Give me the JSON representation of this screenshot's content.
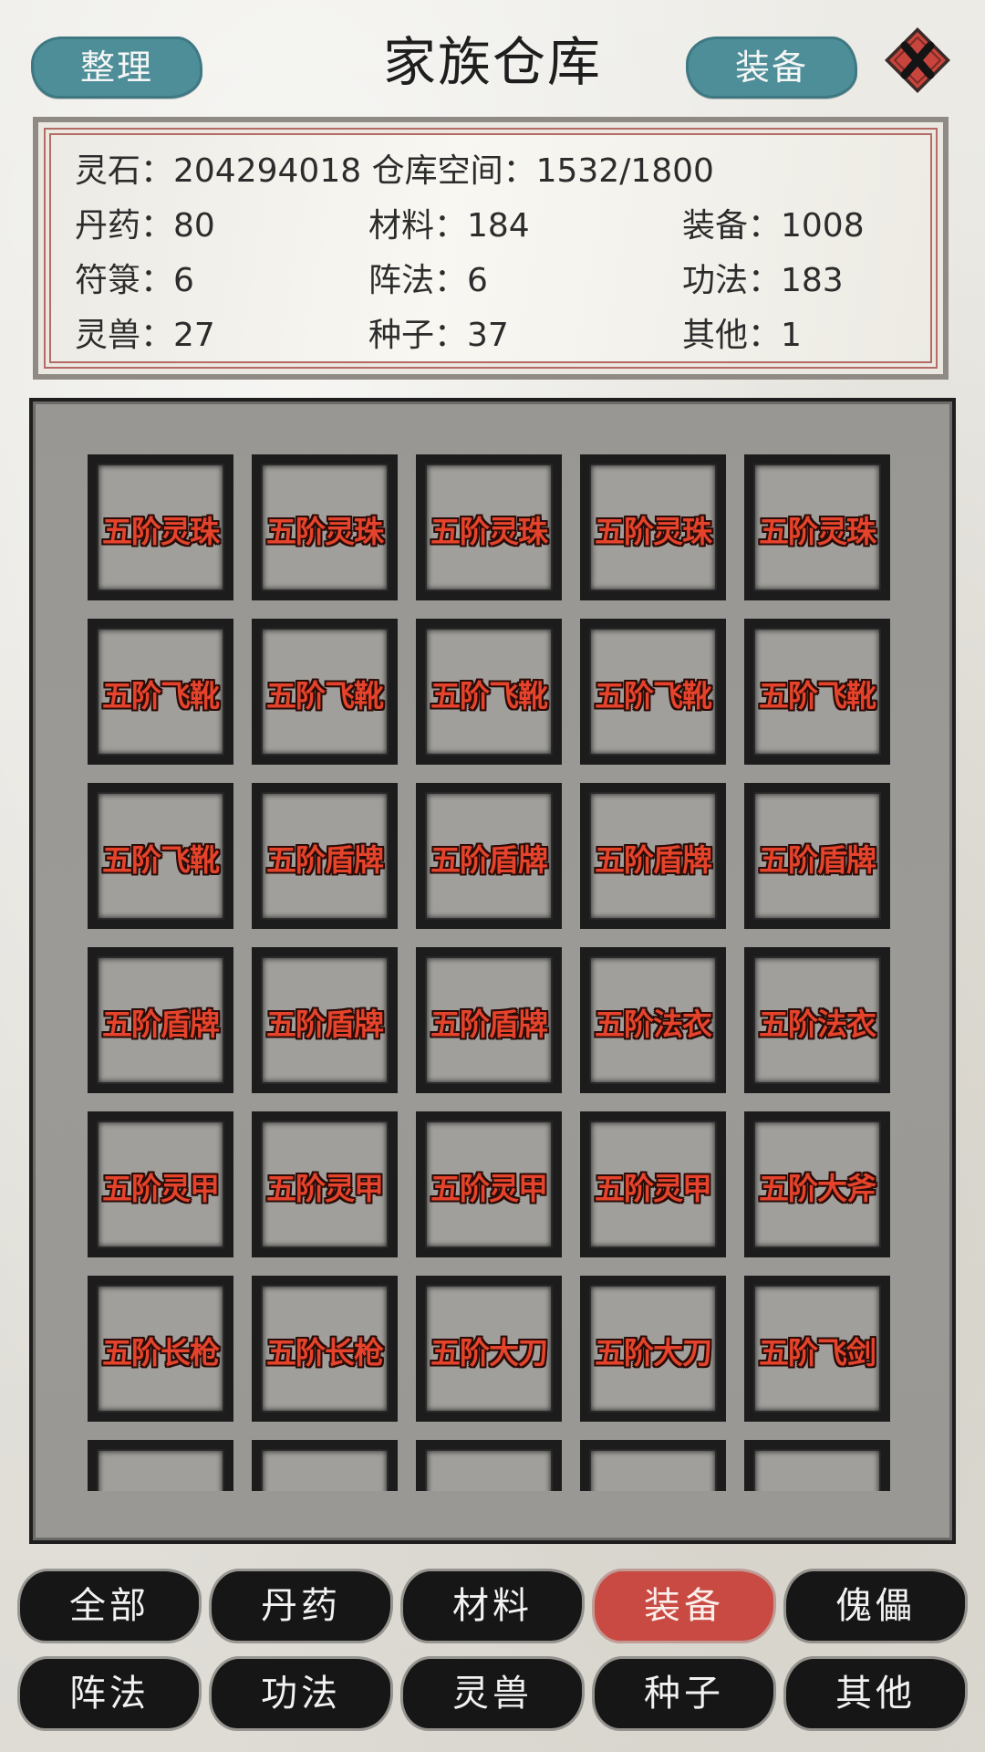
{
  "header": {
    "sort_label": "整理",
    "title": "家族仓库",
    "equip_label": "装备"
  },
  "stats": {
    "line1": "灵石：204294018 仓库空间：1532/1800",
    "rows": [
      [
        "丹药：80",
        "材料：184",
        "装备：1008"
      ],
      [
        "符箓：6",
        "阵法：6",
        "功法：183"
      ],
      [
        "灵兽：27",
        "种子：37",
        "其他：1"
      ]
    ]
  },
  "items": [
    "五阶灵珠",
    "五阶灵珠",
    "五阶灵珠",
    "五阶灵珠",
    "五阶灵珠",
    "五阶飞靴",
    "五阶飞靴",
    "五阶飞靴",
    "五阶飞靴",
    "五阶飞靴",
    "五阶飞靴",
    "五阶盾牌",
    "五阶盾牌",
    "五阶盾牌",
    "五阶盾牌",
    "五阶盾牌",
    "五阶盾牌",
    "五阶盾牌",
    "五阶法衣",
    "五阶法衣",
    "五阶灵甲",
    "五阶灵甲",
    "五阶灵甲",
    "五阶灵甲",
    "五阶大斧",
    "五阶长枪",
    "五阶长枪",
    "五阶大刀",
    "五阶大刀",
    "五阶飞剑",
    "",
    "",
    "",
    "",
    ""
  ],
  "tabs": [
    {
      "label": "全部"
    },
    {
      "label": "丹药"
    },
    {
      "label": "材料"
    },
    {
      "label": "装备"
    },
    {
      "label": "傀儡"
    },
    {
      "label": "阵法"
    },
    {
      "label": "功法"
    },
    {
      "label": "灵兽"
    },
    {
      "label": "种子"
    },
    {
      "label": "其他"
    }
  ],
  "active_tab": "装备",
  "colors": {
    "header_button": "#4e8e98",
    "active_tab": "#c94a42",
    "item_text": "#e5432b",
    "close_button": "#c7453d"
  },
  "icons": {
    "close": "close-icon"
  }
}
